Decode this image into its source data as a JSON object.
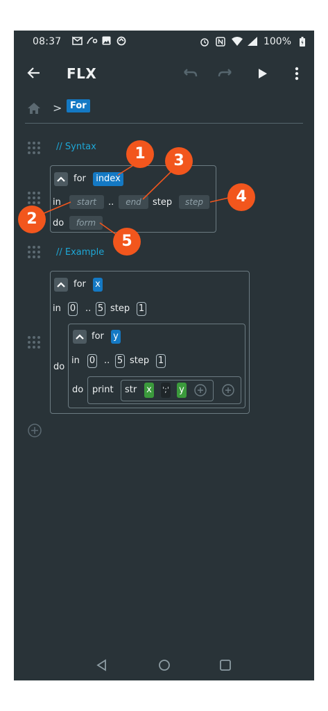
{
  "status": {
    "time": "08:37",
    "battery": "100%",
    "left_icons": [
      "gmail-icon",
      "data-icon",
      "image-icon",
      "sync-icon"
    ],
    "right_icons": [
      "alarm-icon",
      "nfc-icon",
      "wifi-icon",
      "signal-icon",
      "battery-icon"
    ]
  },
  "appbar": {
    "title": "FLX",
    "actions": [
      "undo-icon",
      "redo-icon",
      "run-icon",
      "more-vert-icon"
    ]
  },
  "breadcrumb": {
    "chevron": ">",
    "current": "For"
  },
  "syntax": {
    "comment": "// Syntax",
    "for_kw": "for",
    "index": "index",
    "in_kw": "in",
    "start": "start",
    "range": "..",
    "end": "end",
    "step_kw": "step",
    "step": "step",
    "do_kw": "do",
    "form": "form"
  },
  "example": {
    "comment": "// Example",
    "outer": {
      "for_kw": "for",
      "var": "x",
      "in_kw": "in",
      "from": "0",
      "range": "..",
      "to": "5",
      "step_kw": "step",
      "step": "1",
      "do_kw": "do"
    },
    "inner": {
      "for_kw": "for",
      "var": "y",
      "in_kw": "in",
      "from": "0",
      "range": "..",
      "to": "5",
      "step_kw": "step",
      "step": "1",
      "do_kw": "do",
      "print_kw": "print",
      "str_kw": "str",
      "arg1": "x",
      "arg2": "';'",
      "arg3": "y"
    }
  },
  "callouts": [
    "1",
    "2",
    "3",
    "4",
    "5"
  ],
  "colors": {
    "background": "#293338",
    "accent": "#1479c4",
    "comment": "#1ea7d6",
    "symbol": "#3b9a3c",
    "callout": "#f2561d"
  }
}
